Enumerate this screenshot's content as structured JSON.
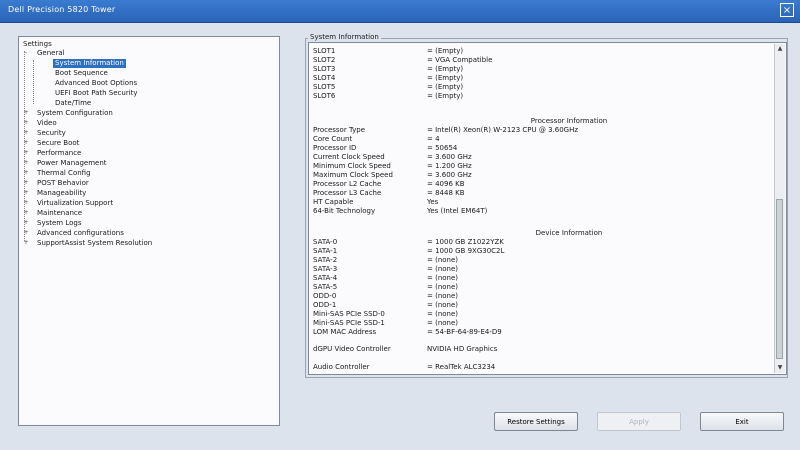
{
  "window": {
    "title": "Dell Precision 5820 Tower",
    "close_glyph": "×"
  },
  "tree": {
    "root": "Settings",
    "general": "General",
    "general_children": [
      "System Information",
      "Boot Sequence",
      "Advanced Boot Options",
      "UEFI Boot Path Security",
      "Date/Time"
    ],
    "others": [
      "System Configuration",
      "Video",
      "Security",
      "Secure Boot",
      "Performance",
      "Power Management",
      "Thermal Config",
      "POST Behavior",
      "Manageability",
      "Virtualization Support",
      "Maintenance",
      "System Logs",
      "Advanced configurations",
      "SupportAssist System Resolution"
    ],
    "selected": "System Information",
    "expand_plus": "+",
    "expand_minus": "-"
  },
  "panel": {
    "title": "System Information",
    "slots": [
      {
        "k": "SLOT1",
        "v": "= (Empty)"
      },
      {
        "k": "SLOT2",
        "v": "= VGA Compatible"
      },
      {
        "k": "SLOT3",
        "v": "= (Empty)"
      },
      {
        "k": "SLOT4",
        "v": "= (Empty)"
      },
      {
        "k": "SLOT5",
        "v": "= (Empty)"
      },
      {
        "k": "SLOT6",
        "v": "= (Empty)"
      }
    ],
    "processor_heading": "Processor Information",
    "processor": [
      {
        "k": "Processor Type",
        "v": "= Intel(R) Xeon(R) W-2123 CPU @ 3.60GHz"
      },
      {
        "k": "Core Count",
        "v": "= 4"
      },
      {
        "k": "Processor ID",
        "v": "= 50654"
      },
      {
        "k": "Current Clock Speed",
        "v": "= 3.600 GHz"
      },
      {
        "k": "Minimum Clock Speed",
        "v": "= 1.200 GHz"
      },
      {
        "k": "Maximum Clock Speed",
        "v": "= 3.600 GHz"
      },
      {
        "k": "Processor L2 Cache",
        "v": "= 4096 KB"
      },
      {
        "k": "Processor L3 Cache",
        "v": "= 8448 KB"
      },
      {
        "k": "HT Capable",
        "v": "Yes"
      },
      {
        "k": "64-Bit Technology",
        "v": "Yes (Intel EM64T)"
      }
    ],
    "device_heading": "Device Information",
    "devices": [
      {
        "k": "SATA-0",
        "v": "= 1000 GB Z1022YZK"
      },
      {
        "k": "SATA-1",
        "v": "= 1000 GB 9XG30C2L"
      },
      {
        "k": "SATA-2",
        "v": "= (none)"
      },
      {
        "k": "SATA-3",
        "v": "= (none)"
      },
      {
        "k": "SATA-4",
        "v": "= (none)"
      },
      {
        "k": "SATA-5",
        "v": "= (none)"
      },
      {
        "k": "ODD-0",
        "v": "= (none)"
      },
      {
        "k": "ODD-1",
        "v": "= (none)"
      },
      {
        "k": "Mini-SAS PCIe SSD-0",
        "v": "= (none)"
      },
      {
        "k": "Mini-SAS PCIe SSD-1",
        "v": "= (none)"
      },
      {
        "k": "LOM MAC Address",
        "v": "= 54-BF-64-89-E4-D9"
      }
    ],
    "dgpu": {
      "k": "dGPU Video Controller",
      "v": "NVIDIA HD Graphics"
    },
    "audio": {
      "k": "Audio Controller",
      "v": "= RealTek ALC3234"
    }
  },
  "scrollbar": {
    "up_glyph": "▲",
    "down_glyph": "▼"
  },
  "buttons": {
    "restore": "Restore Settings",
    "apply": "Apply",
    "exit": "Exit"
  }
}
